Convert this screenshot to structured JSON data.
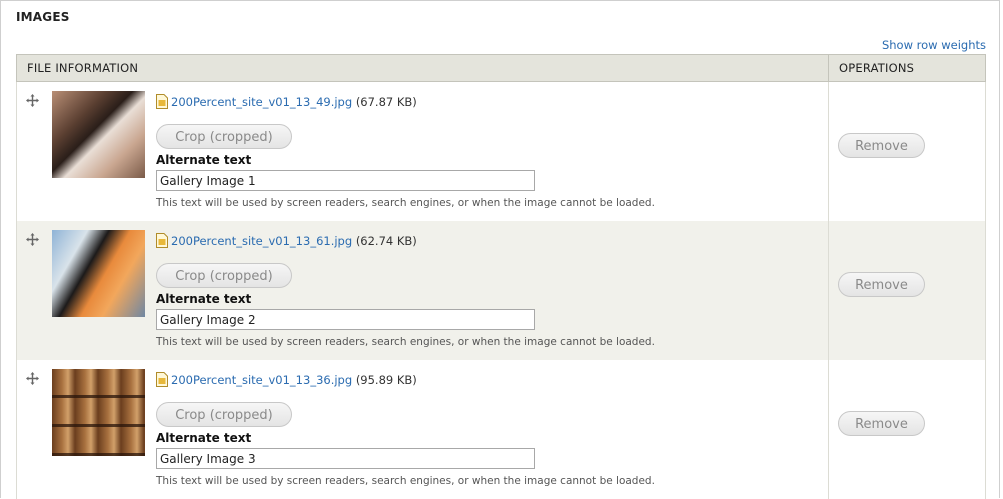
{
  "fieldset": {
    "title": "IMAGES"
  },
  "toggle_weights": "Show row weights",
  "table": {
    "headers": {
      "file_information": "FILE INFORMATION",
      "operations": "OPERATIONS"
    },
    "rows": [
      {
        "filename": "200Percent_site_v01_13_49.jpg",
        "size": "(67.87 KB)",
        "crop_label": "Crop (cropped)",
        "alt_label": "Alternate text",
        "alt_value": "Gallery Image 1",
        "alt_description": "This text will be used by screen readers, search engines, or when the image cannot be loaded.",
        "remove_label": "Remove"
      },
      {
        "filename": "200Percent_site_v01_13_61.jpg",
        "size": "(62.74 KB)",
        "crop_label": "Crop (cropped)",
        "alt_label": "Alternate text",
        "alt_value": "Gallery Image 2",
        "alt_description": "This text will be used by screen readers, search engines, or when the image cannot be loaded.",
        "remove_label": "Remove"
      },
      {
        "filename": "200Percent_site_v01_13_36.jpg",
        "size": "(95.89 KB)",
        "crop_label": "Crop (cropped)",
        "alt_label": "Alternate text",
        "alt_value": "Gallery Image 3",
        "alt_description": "This text will be used by screen readers, search engines, or when the image cannot be loaded.",
        "remove_label": "Remove"
      }
    ]
  },
  "icons": {
    "drag": "drag-handle-icon",
    "file": "image-file-icon"
  },
  "colors": {
    "link": "#2a6bb0",
    "header_bg": "#e4e4dc",
    "stripe": "#f1f1eb"
  }
}
